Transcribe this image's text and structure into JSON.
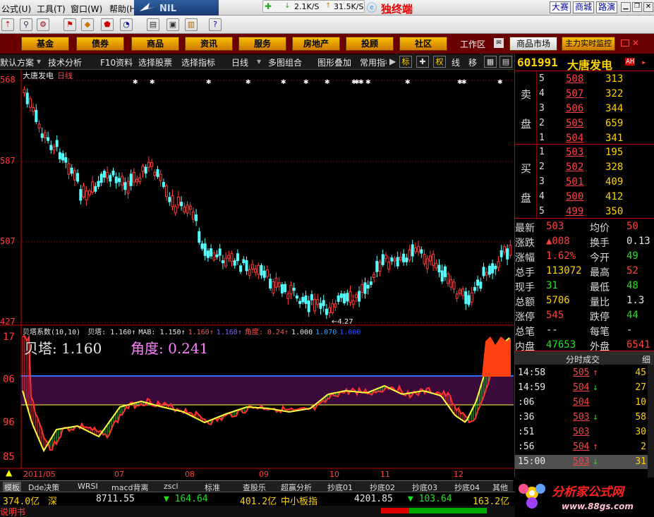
{
  "titlebar": {
    "menus": [
      "公式(U)",
      "工具(T)",
      "窗口(W)",
      "帮助(H)"
    ],
    "net_down": "2.1K/S",
    "net_up": "31.5K/S",
    "terminal_title": "独终端",
    "quick_buttons": [
      "大赛",
      "商城",
      "路演"
    ]
  },
  "catbar": {
    "buttons": [
      "基金",
      "债券",
      "商品",
      "资讯",
      "服务",
      "房地产",
      "投顾",
      "社区"
    ],
    "workspace": "工作区",
    "market": "商品市场",
    "monitor": "主力实时监控"
  },
  "toolbar2": {
    "items": [
      "默认方案",
      "技术分析",
      "F10资料",
      "选择股票",
      "选择指标",
      "日线",
      "多图组合",
      "图形叠加",
      "常用指标"
    ],
    "square_buttons": [
      "标",
      "十",
      "权",
      "线",
      "移"
    ]
  },
  "stock": {
    "code": "601991",
    "name": "大唐发电",
    "badge": "AH",
    "period": "日线"
  },
  "price_axis": [
    "568",
    "587",
    "507",
    "427"
  ],
  "indicator": {
    "header_name": "贝塔系数(10,10)",
    "header_values": [
      {
        "t": "贝塔: 1.160↑",
        "c": "#e8e8e8"
      },
      {
        "t": "MAB: 1.150↑",
        "c": "#e8e8e8"
      },
      {
        "t": "1.160↑",
        "c": "#ff5050"
      },
      {
        "t": "1.160↑",
        "c": "#8060ff"
      },
      {
        "t": "角度: 0.24↑",
        "c": "#ff5050"
      },
      {
        "t": "1.000",
        "c": "#e8e8e8"
      },
      {
        "t": "1.070",
        "c": "#30a0ff"
      },
      {
        "t": "1.000",
        "c": "#3050ff"
      }
    ],
    "big_beta": "贝塔: 1.160",
    "big_angle": "角度: 0.241",
    "axis": [
      "17",
      "06",
      "96",
      "85"
    ],
    "low_marker": "←4.27"
  },
  "date_axis": [
    "2011/05",
    "07",
    "08",
    "09",
    "10",
    "11",
    "12"
  ],
  "orderbook": {
    "sell_label": [
      "卖",
      "盘"
    ],
    "buy_label": [
      "买",
      "盘"
    ],
    "sell": [
      {
        "lvl": "5",
        "price": "508",
        "vol": "313"
      },
      {
        "lvl": "4",
        "price": "507",
        "vol": "322"
      },
      {
        "lvl": "3",
        "price": "506",
        "vol": "344"
      },
      {
        "lvl": "2",
        "price": "505",
        "vol": "659"
      },
      {
        "lvl": "1",
        "price": "504",
        "vol": "341"
      }
    ],
    "buy": [
      {
        "lvl": "1",
        "price": "503",
        "vol": "195"
      },
      {
        "lvl": "2",
        "price": "502",
        "vol": "328"
      },
      {
        "lvl": "3",
        "price": "501",
        "vol": "409"
      },
      {
        "lvl": "4",
        "price": "500",
        "vol": "412"
      },
      {
        "lvl": "5",
        "price": "499",
        "vol": "350"
      }
    ]
  },
  "quote": [
    {
      "k1": "最新",
      "v1": "503",
      "c1": "red",
      "k2": "均价",
      "v2": "50",
      "c2": "red"
    },
    {
      "k1": "涨跌",
      "v1": "▲008",
      "c1": "red",
      "k2": "换手",
      "v2": "0.13",
      "c2": "wht"
    },
    {
      "k1": "涨幅",
      "v1": "1.62%",
      "c1": "red",
      "k2": "今开",
      "v2": "49",
      "c2": "grn"
    },
    {
      "k1": "总手",
      "v1": "113072",
      "c1": "yel",
      "k2": "最高",
      "v2": "52",
      "c2": "red"
    },
    {
      "k1": "现手",
      "v1": "31",
      "c1": "grn",
      "k2": "最低",
      "v2": "48",
      "c2": "grn"
    },
    {
      "k1": "总额",
      "v1": "5706",
      "c1": "yel",
      "k2": "量比",
      "v2": "1.3",
      "c2": "wht"
    },
    {
      "k1": "涨停",
      "v1": "545",
      "c1": "red",
      "k2": "跌停",
      "v2": "44",
      "c2": "grn"
    },
    {
      "k1": "总笔",
      "v1": "--",
      "c1": "wht",
      "k2": "每笔",
      "v2": "-",
      "c2": "wht"
    },
    {
      "k1": "内盘",
      "v1": "47653",
      "c1": "grn",
      "k2": "外盘",
      "v2": "6541",
      "c2": "red"
    }
  ],
  "ticks_header": "分时成交",
  "ticks_tab2": "细",
  "ticks": [
    {
      "t": "14:58",
      "p": "505",
      "a": "↑",
      "v": "45",
      "c": "red"
    },
    {
      "t": "14:59",
      "p": "504",
      "a": "↓",
      "v": "27",
      "c": "red"
    },
    {
      "t": ":06",
      "p": "504",
      "a": "",
      "v": "10",
      "c": "red"
    },
    {
      "t": ":36",
      "p": "503",
      "a": "↓",
      "v": "58",
      "c": "red"
    },
    {
      "t": ":51",
      "p": "503",
      "a": "",
      "v": "30",
      "c": "red"
    },
    {
      "t": ":56",
      "p": "504",
      "a": "↑",
      "v": "2",
      "c": "red"
    },
    {
      "t": "15:00",
      "p": "503",
      "a": "↓",
      "v": "31",
      "c": "red"
    }
  ],
  "tabs": [
    "模板",
    "Dde决策",
    "WRSI",
    "macd背离",
    "zscl",
    "标准",
    "查股乐",
    "超赢分析",
    "抄底01",
    "抄底02",
    "抄底03",
    "抄底04",
    "其他"
  ],
  "ticker": [
    {
      "t": "374.0亿",
      "c": "yel"
    },
    {
      "t": "深",
      "c": "yel"
    },
    {
      "t": "8711.55",
      "c": "wht"
    },
    {
      "t": "▼ 164.64",
      "c": "grn"
    },
    {
      "t": "401.2亿",
      "c": "yel"
    },
    {
      "t": "中小板指",
      "c": "yel"
    },
    {
      "t": "4201.85",
      "c": "wht"
    },
    {
      "t": "▼ 103.64",
      "c": "grn"
    },
    {
      "t": "163.2亿",
      "c": "yel"
    }
  ],
  "status_text": "说明书",
  "logo": {
    "name": "分析家公式网",
    "url": "www.88gs.com"
  },
  "colors": {
    "up": "#ff3c3c",
    "down": "#54ffff",
    "beta": "#ffff40",
    "mab": "#ff4040",
    "band": "#3a0a3a"
  }
}
